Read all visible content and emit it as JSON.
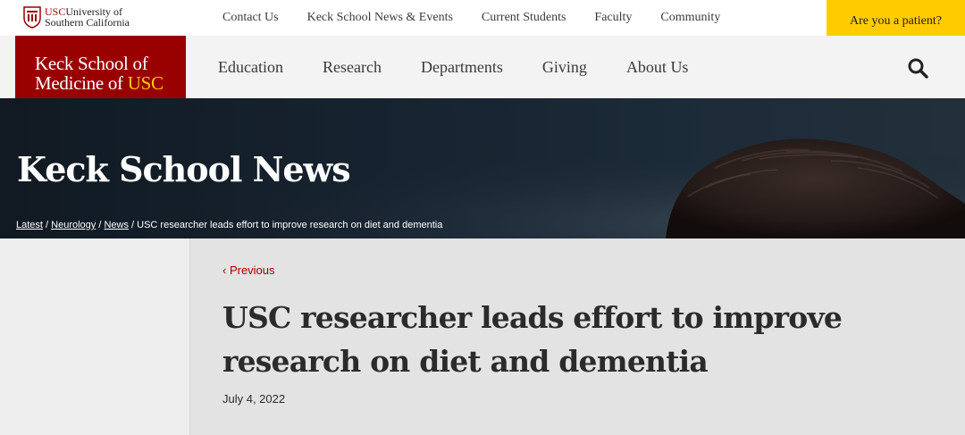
{
  "utility_bar": {
    "logo": {
      "usc": "USC",
      "line1": "University of",
      "line2": "Southern California"
    },
    "links": [
      "Contact Us",
      "Keck School News & Events",
      "Current Students",
      "Faculty",
      "Community"
    ],
    "patient_button": "Are you a patient?"
  },
  "main_nav": {
    "logo": {
      "line1": "Keck School of",
      "line2_prefix": "Medicine of ",
      "line2_accent": "USC"
    },
    "items": [
      "Education",
      "Research",
      "Departments",
      "Giving",
      "About Us"
    ],
    "search_icon": "search-icon"
  },
  "hero": {
    "title": "Keck School News",
    "breadcrumb": {
      "links": [
        "Latest",
        "Neurology",
        "News"
      ],
      "separator": " / ",
      "current": "USC researcher leads effort to improve research on diet and dementia"
    }
  },
  "article": {
    "previous": "‹ Previous",
    "title": "USC researcher leads effort to improve research on diet and dementia",
    "date": "July 4, 2022"
  },
  "colors": {
    "usc_cardinal": "#990000",
    "usc_gold": "#ffcc00",
    "nav_background": "#f3f3f3",
    "content_background": "#e3e3e3"
  }
}
